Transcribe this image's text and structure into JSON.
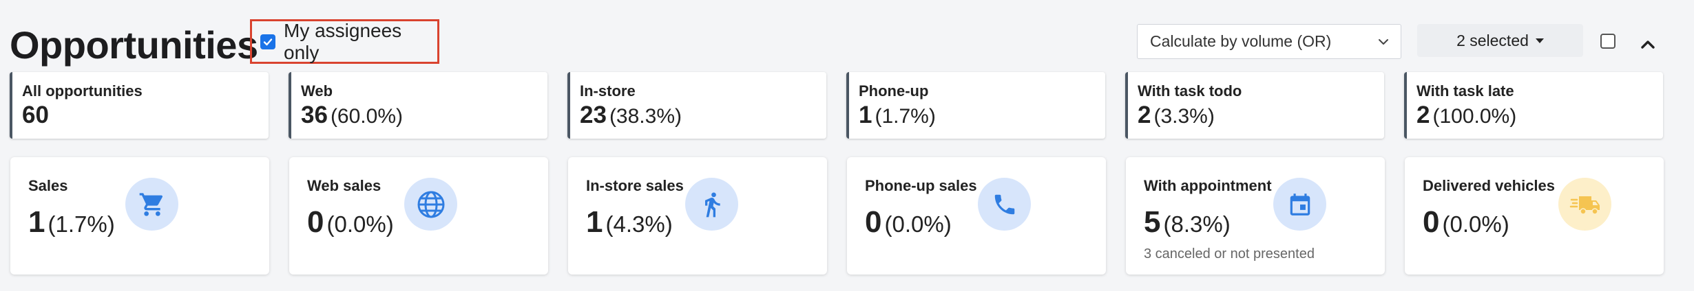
{
  "header": {
    "title": "Opportunities",
    "assignee_filter": {
      "label": "My assignees only",
      "checked": true
    },
    "calculate_select": {
      "value": "Calculate by volume (OR)"
    },
    "selected_dropdown": {
      "label": "2 selected"
    }
  },
  "summary_cards": [
    {
      "label": "All opportunities",
      "value": "60",
      "pct": ""
    },
    {
      "label": "Web",
      "value": "36",
      "pct": "(60.0%)"
    },
    {
      "label": "In-store",
      "value": "23",
      "pct": "(38.3%)"
    },
    {
      "label": "Phone-up",
      "value": "1",
      "pct": "(1.7%)"
    },
    {
      "label": "With task todo",
      "value": "2",
      "pct": "(3.3%)"
    },
    {
      "label": "With task late",
      "value": "2",
      "pct": "(100.0%)"
    }
  ],
  "stat_cards": [
    {
      "label": "Sales",
      "value": "1",
      "pct": "(1.7%)",
      "icon": "cart-icon",
      "sub": ""
    },
    {
      "label": "Web sales",
      "value": "0",
      "pct": "(0.0%)",
      "icon": "globe-icon",
      "sub": ""
    },
    {
      "label": "In-store sales",
      "value": "1",
      "pct": "(4.3%)",
      "icon": "walking-person-icon",
      "sub": ""
    },
    {
      "label": "Phone-up sales",
      "value": "0",
      "pct": "(0.0%)",
      "icon": "phone-icon",
      "sub": ""
    },
    {
      "label": "With appointment",
      "value": "5",
      "pct": "(8.3%)",
      "icon": "calendar-icon",
      "sub": "3 canceled or not presented"
    },
    {
      "label": "Delivered vehicles",
      "value": "0",
      "pct": "(0.0%)",
      "icon": "delivery-truck-icon",
      "sub": ""
    }
  ],
  "colors": {
    "accent_blue": "#2f7de1",
    "icon_bg_blue": "#d7e5fb",
    "icon_bg_yellow": "#fdefc9",
    "truck_yellow": "#f5c451",
    "highlight_red": "#d9432f"
  }
}
